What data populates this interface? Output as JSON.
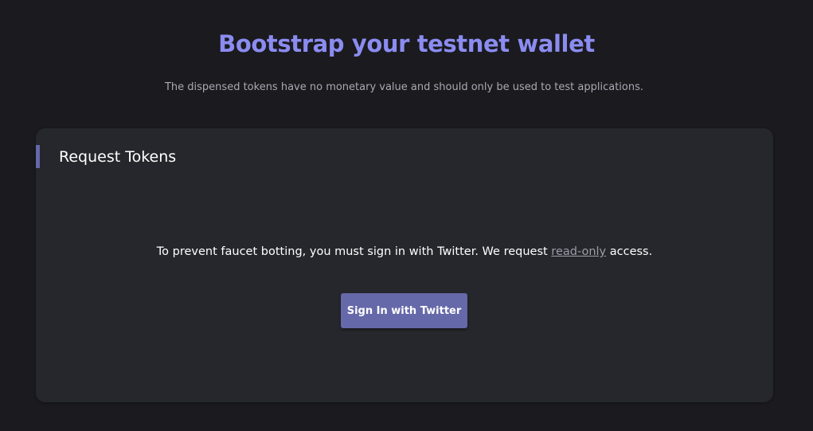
{
  "header": {
    "title": "Bootstrap your testnet wallet",
    "subtitle": "The dispensed tokens have no monetary value and should only be used to test applications."
  },
  "card": {
    "title": "Request Tokens",
    "message_before": "To prevent faucet botting, you must sign in with Twitter. We request ",
    "message_link": "read-only",
    "message_after": " access.",
    "button_label": "Sign In with Twitter"
  },
  "colors": {
    "background": "#1a1a1f",
    "card_background": "#26272c",
    "title_accent": "#8b8cf0",
    "button": "#6568a9"
  }
}
